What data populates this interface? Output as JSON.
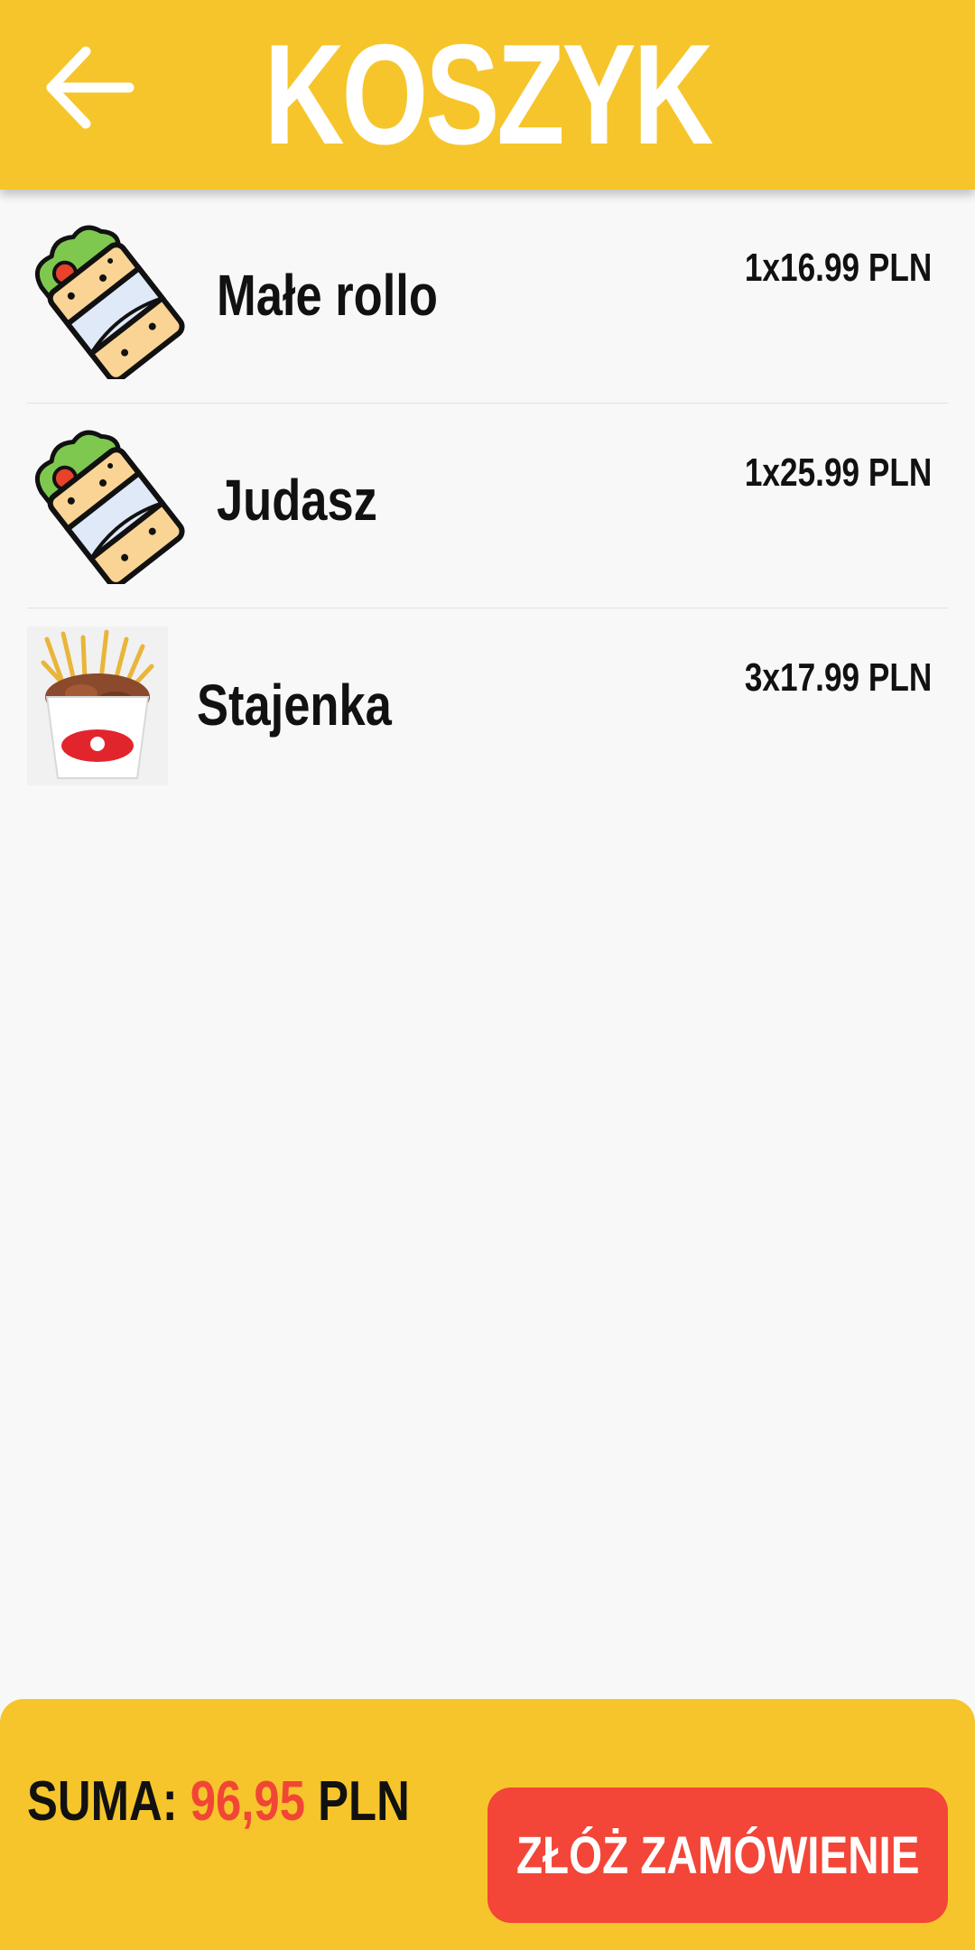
{
  "header": {
    "title": "KOSZYK",
    "back_icon": "arrow-left-icon"
  },
  "cart": {
    "items": [
      {
        "name": "Małe rollo",
        "price": "1x16.99 PLN",
        "icon": "wrap-icon"
      },
      {
        "name": "Judasz",
        "price": "1x25.99 PLN",
        "icon": "wrap-icon"
      },
      {
        "name": "Stajenka",
        "price": "3x17.99 PLN",
        "icon": "kebab-box-photo"
      }
    ]
  },
  "footer": {
    "sum_label": "SUMA:",
    "sum_value": "96,95",
    "sum_currency": "PLN",
    "order_button": "ZŁÓŻ ZAMÓWIENIE"
  },
  "colors": {
    "brand_yellow": "#f6c52b",
    "accent_red": "#f34538",
    "background": "#f8f8f8"
  }
}
